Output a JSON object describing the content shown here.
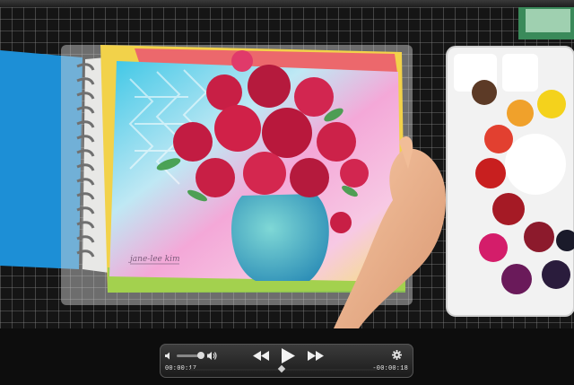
{
  "player": {
    "elapsed_time": "00:00:17",
    "remaining_time": "-00:00:18",
    "playback_progress": 0.49,
    "volume_level": 0.75,
    "icons": {
      "volume_low": "speaker-low-icon",
      "volume_high": "speaker-high-icon",
      "rewind": "rewind-icon",
      "play": "play-icon",
      "fast_forward": "fast-forward-icon",
      "settings": "gear-icon"
    }
  },
  "video": {
    "signature_text": "jane-lee kim"
  },
  "colors": {
    "control_bar": "#2a2a2a",
    "blue_cover": "#1d8fd6",
    "flowers": "#c81f45",
    "vase": "#4fb6c8"
  }
}
